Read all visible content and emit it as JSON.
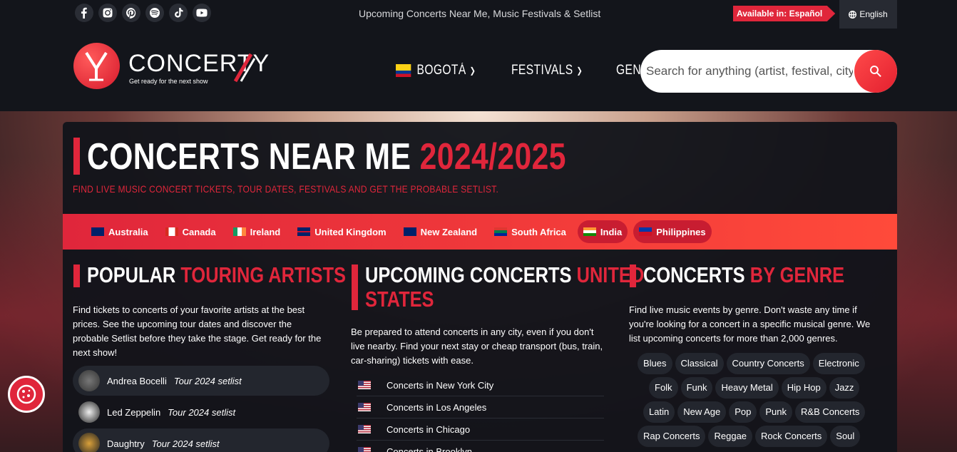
{
  "topbar": {
    "tagline": "Upcoming Concerts Near Me, Music Festivals & Setlist",
    "available_label": "Available in: Español",
    "language": "English",
    "socials": [
      "facebook-icon",
      "instagram-icon",
      "pinterest-icon",
      "spotify-icon",
      "tiktok-icon",
      "youtube-icon"
    ]
  },
  "header": {
    "logo_text": "CONCERTY",
    "logo_tagline": "Get ready for the next show",
    "nav": [
      {
        "label": "BOGOTÁ"
      },
      {
        "label": "FESTIVALS"
      },
      {
        "label": "GENRES"
      }
    ],
    "search_placeholder": "Search for anything (artist, festival, city...)..."
  },
  "hero": {
    "title_white": "CONCERTS NEAR ME",
    "title_red": "2024/2025",
    "subtitle": "FIND LIVE MUSIC CONCERT TICKETS, TOUR DATES, FESTIVALS AND GET THE PROBABLE SETLIST."
  },
  "countries": [
    {
      "label": "Australia",
      "flag": "au"
    },
    {
      "label": "Canada",
      "flag": "ca"
    },
    {
      "label": "Ireland",
      "flag": "ie"
    },
    {
      "label": "United Kingdom",
      "flag": "uk"
    },
    {
      "label": "New Zealand",
      "flag": "nz"
    },
    {
      "label": "South Africa",
      "flag": "za"
    },
    {
      "label": "India",
      "flag": "in"
    },
    {
      "label": "Philippines",
      "flag": "ph"
    }
  ],
  "artists_section": {
    "title_white": "POPULAR",
    "title_red": "TOURING ARTISTS",
    "description": "Find tickets to concerts of your favorite artists at the best prices. See the upcoming tour dates and discover the probable Setlist before they take the stage. Get ready for the next show!",
    "artists": [
      {
        "name": "Andrea Bocelli",
        "tour": "Tour 2024 setlist"
      },
      {
        "name": "Led Zeppelin",
        "tour": "Tour 2024 setlist"
      },
      {
        "name": "Daughtry",
        "tour": "Tour 2024 setlist"
      }
    ]
  },
  "upcoming_section": {
    "title_white": "UPCOMING CONCERTS",
    "title_red_1": "UNITED",
    "title_red_2": "STATES",
    "description": "Be prepared to attend concerts in any city, even if you don't live nearby. Find your next stay or cheap transport (bus, train, car-sharing) tickets with ease.",
    "cities": [
      {
        "label": "Concerts in New York City"
      },
      {
        "label": "Concerts in Los Angeles"
      },
      {
        "label": "Concerts in Chicago"
      },
      {
        "label": "Concerts in Brooklyn"
      }
    ]
  },
  "genre_section": {
    "title_white": "CONCERTS",
    "title_red": "BY GENRE",
    "description": "Find live music events by genre. Don't waste any time if you're looking for a concert in a specific musical genre. We list upcoming concerts for more than 2,000 genres.",
    "genres": [
      "Blues",
      "Classical",
      "Country Concerts",
      "Electronic",
      "Folk",
      "Funk",
      "Heavy Metal",
      "Hip Hop",
      "Jazz",
      "Latin",
      "New Age",
      "Pop",
      "Punk",
      "R&B Concerts",
      "Rap Concerts",
      "Reggae",
      "Rock Concerts",
      "Soul"
    ]
  },
  "colors": {
    "accent": "#e0263b",
    "background": "#13151b"
  }
}
